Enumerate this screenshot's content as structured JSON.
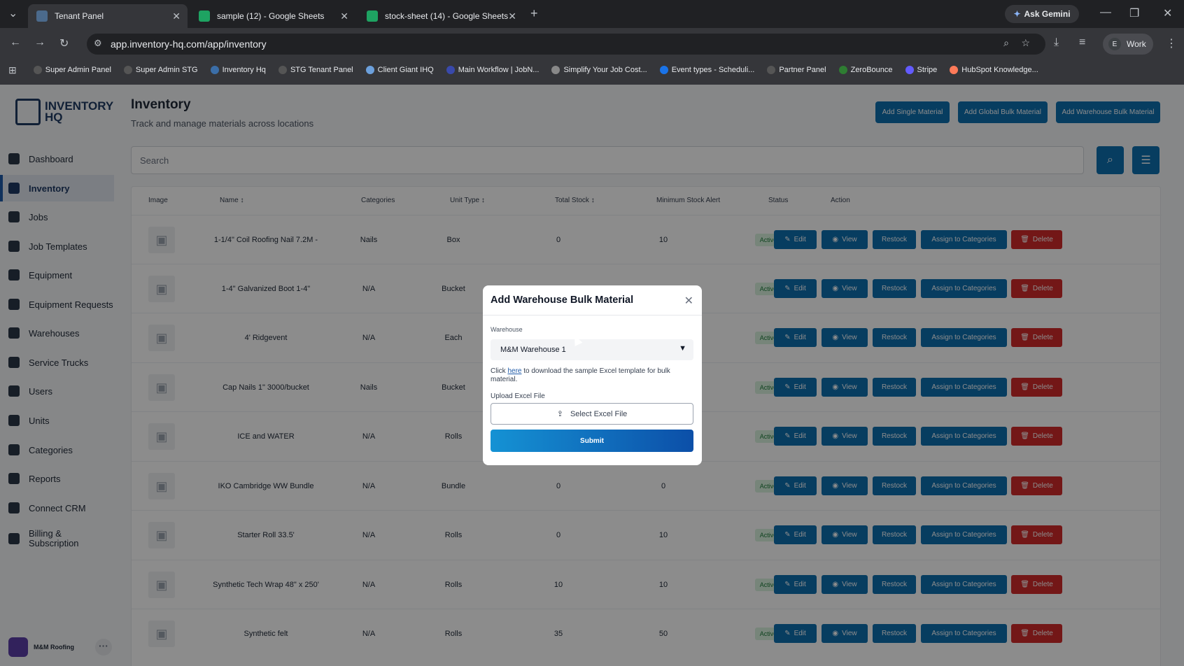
{
  "browser": {
    "tabs": [
      {
        "title": "Tenant Panel",
        "active": true
      },
      {
        "title": "sample (12) - Google Sheets",
        "active": false
      },
      {
        "title": "stock-sheet (14) - Google Sheets",
        "active": false
      }
    ],
    "new_tab": "+",
    "ask_gemini": "Ask Gemini",
    "url": "app.inventory-hq.com/app/inventory",
    "profile_initial": "E",
    "profile_label": "Work",
    "bookmarks": [
      "Super Admin Panel",
      "Super Admin STG",
      "Inventory Hq",
      "STG Tenant Panel",
      "Client Giant IHQ",
      "Main Workflow | JobN...",
      "Simplify Your Job Cost...",
      "Event types - Scheduli...",
      "Partner Panel",
      "ZeroBounce",
      "Stripe",
      "HubSpot Knowledge..."
    ]
  },
  "sidebar": {
    "logo_line1": "INVENTORY",
    "logo_line2": "HQ",
    "items": [
      {
        "label": "Dashboard"
      },
      {
        "label": "Inventory",
        "active": true
      },
      {
        "label": "Jobs"
      },
      {
        "label": "Job Templates"
      },
      {
        "label": "Equipment"
      },
      {
        "label": "Equipment Requests"
      },
      {
        "label": "Warehouses"
      },
      {
        "label": "Service Trucks"
      },
      {
        "label": "Users"
      },
      {
        "label": "Units"
      },
      {
        "label": "Categories"
      },
      {
        "label": "Reports"
      },
      {
        "label": "Connect CRM"
      },
      {
        "label": "Billing & Subscription"
      }
    ],
    "account_name": "M&M Roofing",
    "account_more": "···"
  },
  "header": {
    "title": "Inventory",
    "subtitle": "Track and manage materials across locations",
    "buttons": [
      "Add Single Material",
      "Add Global Bulk Material",
      "Add Warehouse Bulk Material"
    ]
  },
  "search": {
    "placeholder": "Search"
  },
  "table": {
    "columns": [
      "Image",
      "Name",
      "Categories",
      "Unit Type",
      "Total Stock",
      "Minimum Stock Alert",
      "Status",
      "Action"
    ],
    "actions": [
      "Edit",
      "View",
      "Restock",
      "Assign to Categories",
      "Delete"
    ],
    "rows": [
      {
        "name": "1-1/4\" Coil Roofing Nail 7.2M -",
        "category": "Nails",
        "unit": "Box",
        "stock": "0",
        "min": "10",
        "status": "Active"
      },
      {
        "name": "1-4\" Galvanized Boot 1-4\"",
        "category": "N/A",
        "unit": "Bucket",
        "stock": "",
        "min": "",
        "status": "Active"
      },
      {
        "name": "4' Ridgevent",
        "category": "N/A",
        "unit": "Each",
        "stock": "",
        "min": "",
        "status": "Active"
      },
      {
        "name": "Cap Nails 1\" 3000/bucket",
        "category": "Nails",
        "unit": "Bucket",
        "stock": "",
        "min": "",
        "status": "Active"
      },
      {
        "name": "ICE and WATER",
        "category": "N/A",
        "unit": "Rolls",
        "stock": "",
        "min": "",
        "status": "Active"
      },
      {
        "name": "IKO Cambridge WW Bundle",
        "category": "N/A",
        "unit": "Bundle",
        "stock": "0",
        "min": "0",
        "status": "Active"
      },
      {
        "name": "Starter Roll 33.5'",
        "category": "N/A",
        "unit": "Rolls",
        "stock": "0",
        "min": "10",
        "status": "Active"
      },
      {
        "name": "Synthetic Tech Wrap 48\" x 250'",
        "category": "N/A",
        "unit": "Rolls",
        "stock": "10",
        "min": "10",
        "status": "Active"
      },
      {
        "name": "Synthetic felt",
        "category": "N/A",
        "unit": "Rolls",
        "stock": "35",
        "min": "50",
        "status": "Active"
      }
    ]
  },
  "modal": {
    "title": "Add Warehouse Bulk Material",
    "warehouse_label": "Warehouse",
    "warehouse_value": "M&M Warehouse 1",
    "hint_prefix": "Click ",
    "hint_link": "here",
    "hint_suffix": " to download the sample Excel template for bulk material.",
    "upload_label": "Upload Excel File",
    "upload_button": "Select Excel File",
    "submit": "Submit"
  }
}
